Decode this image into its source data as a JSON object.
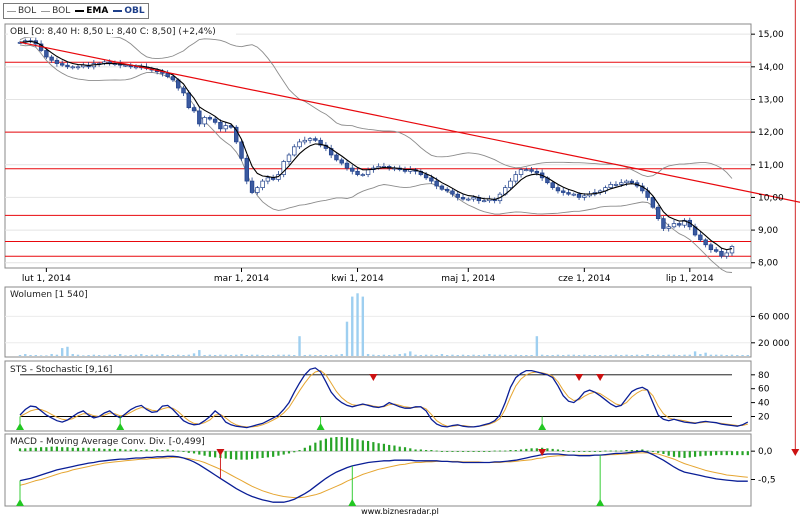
{
  "legend": [
    {
      "label": "BOL",
      "style": "thin"
    },
    {
      "label": "BOL",
      "style": "thin"
    },
    {
      "label": "EMA",
      "style": "ema"
    },
    {
      "label": "OBL",
      "style": "obl"
    }
  ],
  "footer": "www.biznesradar.pl",
  "colors": {
    "candle_body": "#3b5aa0",
    "candle_border": "#1e3f8a",
    "ema": "#000000",
    "bol": "#8c8c8c",
    "hline": "#e8080d",
    "volume": "#9ecff0",
    "stoch_k": "#0a1e96",
    "stoch_d": "#e6a632",
    "macd_pos": "#26a326",
    "macd_neg": "#26a326",
    "marker_up": "#22c722",
    "marker_down": "#cc1111"
  },
  "chart_data": [
    {
      "type": "candlestick",
      "title": "OBL [O: 8,40  H: 8,50  L: 8,40  C: 8,50] (+2,4%)",
      "x_tick_labels": [
        "lut 1, 2014",
        "mar 1, 2014",
        "kwi 1, 2014",
        "maj 1, 2014",
        "cze 1, 2014",
        "lip 1, 2014"
      ],
      "y_tick_labels": [
        "15,00",
        "14,00",
        "13,00",
        "12,00",
        "11,00",
        "10,00",
        "9,00",
        "8,00"
      ],
      "y_ticks": [
        15,
        14,
        13,
        12,
        11,
        10,
        9,
        8
      ],
      "ylim": [
        7.9,
        15.25
      ],
      "horizontal_lines": [
        14.14,
        12.0,
        10.88,
        9.45,
        8.65,
        8.2
      ],
      "trendline": {
        "x": [
          0,
          148
        ],
        "y": [
          14.75,
          9.85
        ]
      },
      "close": [
        14.75,
        14.8,
        14.8,
        14.7,
        14.5,
        14.3,
        14.2,
        14.1,
        14.05,
        14.0,
        14.0,
        14.0,
        14.05,
        14.0,
        14.1,
        14.1,
        14.15,
        14.1,
        14.1,
        14.05,
        14.05,
        14.0,
        14.0,
        14.0,
        13.95,
        13.9,
        13.85,
        13.8,
        13.7,
        13.6,
        13.35,
        13.2,
        12.75,
        12.65,
        12.25,
        12.45,
        12.4,
        12.3,
        12.1,
        12.2,
        12.15,
        11.7,
        11.2,
        10.5,
        10.15,
        10.3,
        10.5,
        10.6,
        10.55,
        10.7,
        11.1,
        11.3,
        11.55,
        11.7,
        11.75,
        11.8,
        11.75,
        11.6,
        11.5,
        11.3,
        11.15,
        11.05,
        10.9,
        10.8,
        10.7,
        10.7,
        10.85,
        10.9,
        10.95,
        10.95,
        10.9,
        10.9,
        10.85,
        10.8,
        10.85,
        10.8,
        10.7,
        10.6,
        10.5,
        10.35,
        10.25,
        10.2,
        10.1,
        10.0,
        9.95,
        9.95,
        10.0,
        9.9,
        9.9,
        9.95,
        9.9,
        10.1,
        10.3,
        10.5,
        10.7,
        10.85,
        10.85,
        10.8,
        10.75,
        10.6,
        10.45,
        10.3,
        10.2,
        10.15,
        10.1,
        10.1,
        10.0,
        10.05,
        10.1,
        10.15,
        10.2,
        10.3,
        10.4,
        10.4,
        10.45,
        10.5,
        10.45,
        10.35,
        10.2,
        10.0,
        9.7,
        9.35,
        9.05,
        9.1,
        9.2,
        9.15,
        9.3,
        9.1,
        8.85,
        8.7,
        8.55,
        8.4,
        8.35,
        8.2,
        8.3,
        8.5
      ]
    },
    {
      "type": "bar",
      "title": "Wolumen [1 540]",
      "y_tick_labels": [
        "60 000",
        "20 000"
      ],
      "y_ticks": [
        60000,
        20000
      ],
      "ylim": [
        0,
        100000
      ],
      "values": [
        1500,
        3000,
        1500,
        1500,
        1000,
        1000,
        3000,
        2000,
        12000,
        14000,
        3000,
        2000,
        1000,
        1500,
        2000,
        1500,
        1000,
        2000,
        1500,
        3000,
        1000,
        1500,
        2000,
        3000,
        1500,
        2000,
        2000,
        3000,
        1500,
        1500,
        2000,
        1500,
        2000,
        4000,
        9000,
        1500,
        2000,
        1500,
        2000,
        2000,
        1500,
        2000,
        3000,
        1500,
        2000,
        2000,
        1500,
        1000,
        1500,
        2000,
        2000,
        2000,
        1500,
        30000,
        1500,
        2000,
        1500,
        1500,
        1500,
        1500,
        2000,
        3000,
        52000,
        90000,
        95000,
        90000,
        3000,
        2000,
        1500,
        2000,
        1500,
        2000,
        3000,
        4000,
        7000,
        2000,
        1500,
        2000,
        2000,
        1500,
        3000,
        1500,
        2000,
        1500,
        2000,
        1500,
        2000,
        1500,
        2000,
        3000,
        2000,
        2000,
        2000,
        1500,
        2000,
        1500,
        1500,
        1500,
        30000,
        2000,
        1500,
        1500,
        2000,
        1500,
        2000,
        2000,
        1500,
        2000,
        1500,
        1500,
        1500,
        1000,
        1500,
        2000,
        1500,
        2000,
        1500,
        2000,
        1500,
        3000,
        1500,
        2000,
        1500,
        2000,
        2000,
        1500,
        2000,
        2000,
        7000,
        3000,
        5000,
        2000,
        2000,
        2000,
        1500,
        2000,
        1500,
        1500,
        1500
      ]
    },
    {
      "type": "line",
      "title": "STS - Stochastic [9,16]",
      "y_tick_labels": [
        "80",
        "60",
        "40",
        "20"
      ],
      "y_ticks": [
        80,
        60,
        40,
        20
      ],
      "ylim": [
        2,
        97
      ],
      "reference_lines": [
        80,
        20
      ],
      "series": [
        {
          "name": "K",
          "values": [
            22,
            30,
            35,
            34,
            28,
            22,
            18,
            14,
            12,
            15,
            20,
            25,
            28,
            22,
            18,
            20,
            25,
            28,
            22,
            18,
            24,
            30,
            34,
            36,
            30,
            26,
            27,
            35,
            36,
            30,
            22,
            14,
            10,
            8,
            9,
            14,
            20,
            28,
            22,
            12,
            8,
            6,
            5,
            4,
            6,
            8,
            10,
            14,
            18,
            22,
            30,
            40,
            55,
            68,
            80,
            88,
            90,
            84,
            70,
            55,
            46,
            40,
            36,
            34,
            36,
            38,
            36,
            34,
            33,
            35,
            40,
            37,
            34,
            32,
            32,
            34,
            34,
            28,
            16,
            9,
            6,
            5,
            7,
            8,
            6,
            5,
            5,
            6,
            8,
            10,
            14,
            22,
            40,
            62,
            76,
            82,
            86,
            86,
            84,
            82,
            80,
            76,
            64,
            50,
            42,
            40,
            46,
            55,
            58,
            55,
            50,
            44,
            38,
            34,
            36,
            46,
            56,
            60,
            62,
            58,
            40,
            22,
            16,
            14,
            16,
            14,
            12,
            11,
            10,
            12,
            13,
            12,
            11,
            9,
            8,
            7,
            6,
            8,
            12
          ]
        },
        {
          "name": "D",
          "values": [
            20,
            24,
            28,
            30,
            30,
            27,
            23,
            19,
            16,
            15,
            17,
            21,
            24,
            24,
            21,
            20,
            22,
            25,
            24,
            21,
            22,
            26,
            30,
            33,
            32,
            29,
            28,
            31,
            33,
            32,
            27,
            20,
            14,
            10,
            9,
            11,
            15,
            22,
            23,
            18,
            12,
            8,
            6,
            5,
            5,
            6,
            8,
            11,
            15,
            19,
            25,
            33,
            45,
            57,
            68,
            78,
            84,
            86,
            80,
            68,
            56,
            47,
            41,
            37,
            36,
            37,
            37,
            35,
            34,
            34,
            37,
            38,
            36,
            34,
            33,
            33,
            34,
            31,
            23,
            14,
            9,
            6,
            6,
            7,
            7,
            6,
            5,
            6,
            7,
            9,
            12,
            17,
            30,
            48,
            64,
            74,
            80,
            83,
            84,
            83,
            81,
            78,
            70,
            58,
            48,
            43,
            44,
            49,
            53,
            55,
            53,
            48,
            43,
            38,
            36,
            40,
            48,
            54,
            58,
            58,
            50,
            35,
            24,
            18,
            16,
            15,
            14,
            12,
            11,
            11,
            12,
            12,
            11,
            10,
            9,
            8,
            7,
            7,
            9
          ]
        }
      ],
      "markers": [
        {
          "type": "up",
          "x": 0
        },
        {
          "type": "up",
          "x": 19
        },
        {
          "type": "up",
          "x": 57
        },
        {
          "type": "down",
          "x": 67
        },
        {
          "type": "up",
          "x": 99
        },
        {
          "type": "down",
          "x": 106
        },
        {
          "type": "down",
          "x": 110
        }
      ]
    },
    {
      "type": "line",
      "title": "MACD - Moving Average Conv. Div. [-0,499]",
      "y_tick_labels": [
        "0,0",
        "-0,5"
      ],
      "y_ticks": [
        0,
        -0.5
      ],
      "ylim": [
        -0.95,
        0.25
      ],
      "series": [
        {
          "name": "MACD",
          "values": [
            -0.52,
            -0.5,
            -0.48,
            -0.45,
            -0.42,
            -0.39,
            -0.36,
            -0.33,
            -0.31,
            -0.29,
            -0.27,
            -0.25,
            -0.23,
            -0.21,
            -0.2,
            -0.18,
            -0.17,
            -0.16,
            -0.15,
            -0.14,
            -0.14,
            -0.13,
            -0.12,
            -0.12,
            -0.11,
            -0.11,
            -0.1,
            -0.1,
            -0.09,
            -0.09,
            -0.1,
            -0.12,
            -0.15,
            -0.19,
            -0.24,
            -0.3,
            -0.36,
            -0.42,
            -0.48,
            -0.54,
            -0.6,
            -0.66,
            -0.71,
            -0.76,
            -0.8,
            -0.83,
            -0.86,
            -0.88,
            -0.9,
            -0.9,
            -0.9,
            -0.88,
            -0.85,
            -0.8,
            -0.75,
            -0.69,
            -0.62,
            -0.55,
            -0.48,
            -0.42,
            -0.37,
            -0.33,
            -0.29,
            -0.26,
            -0.24,
            -0.22,
            -0.2,
            -0.19,
            -0.18,
            -0.17,
            -0.17,
            -0.16,
            -0.16,
            -0.16,
            -0.16,
            -0.17,
            -0.17,
            -0.17,
            -0.17,
            -0.17,
            -0.18,
            -0.18,
            -0.19,
            -0.19,
            -0.2,
            -0.2,
            -0.2,
            -0.2,
            -0.2,
            -0.2,
            -0.19,
            -0.19,
            -0.18,
            -0.17,
            -0.16,
            -0.14,
            -0.12,
            -0.1,
            -0.08,
            -0.06,
            -0.05,
            -0.05,
            -0.05,
            -0.06,
            -0.07,
            -0.07,
            -0.08,
            -0.08,
            -0.08,
            -0.07,
            -0.07,
            -0.06,
            -0.05,
            -0.04,
            -0.04,
            -0.03,
            -0.02,
            -0.01,
            0.0,
            -0.02,
            -0.06,
            -0.11,
            -0.16,
            -0.22,
            -0.28,
            -0.33,
            -0.37,
            -0.39,
            -0.41,
            -0.43,
            -0.45,
            -0.47,
            -0.49,
            -0.5,
            -0.51,
            -0.52,
            -0.53,
            -0.53,
            -0.53
          ]
        },
        {
          "name": "Signal",
          "values": [
            -0.6,
            -0.58,
            -0.55,
            -0.52,
            -0.5,
            -0.47,
            -0.44,
            -0.41,
            -0.38,
            -0.36,
            -0.33,
            -0.31,
            -0.29,
            -0.27,
            -0.25,
            -0.23,
            -0.21,
            -0.2,
            -0.19,
            -0.18,
            -0.17,
            -0.16,
            -0.15,
            -0.14,
            -0.14,
            -0.13,
            -0.13,
            -0.12,
            -0.12,
            -0.11,
            -0.11,
            -0.12,
            -0.13,
            -0.15,
            -0.17,
            -0.2,
            -0.24,
            -0.28,
            -0.32,
            -0.37,
            -0.42,
            -0.47,
            -0.52,
            -0.57,
            -0.62,
            -0.66,
            -0.7,
            -0.73,
            -0.76,
            -0.78,
            -0.8,
            -0.81,
            -0.82,
            -0.82,
            -0.81,
            -0.79,
            -0.77,
            -0.74,
            -0.7,
            -0.66,
            -0.62,
            -0.58,
            -0.53,
            -0.49,
            -0.45,
            -0.41,
            -0.38,
            -0.35,
            -0.32,
            -0.3,
            -0.28,
            -0.26,
            -0.24,
            -0.23,
            -0.21,
            -0.2,
            -0.2,
            -0.19,
            -0.19,
            -0.18,
            -0.18,
            -0.18,
            -0.18,
            -0.18,
            -0.19,
            -0.19,
            -0.19,
            -0.19,
            -0.2,
            -0.2,
            -0.2,
            -0.2,
            -0.19,
            -0.19,
            -0.18,
            -0.17,
            -0.16,
            -0.15,
            -0.13,
            -0.12,
            -0.1,
            -0.09,
            -0.08,
            -0.08,
            -0.07,
            -0.07,
            -0.07,
            -0.07,
            -0.07,
            -0.07,
            -0.07,
            -0.07,
            -0.06,
            -0.06,
            -0.05,
            -0.05,
            -0.04,
            -0.03,
            -0.03,
            -0.03,
            -0.04,
            -0.05,
            -0.08,
            -0.11,
            -0.14,
            -0.18,
            -0.22,
            -0.25,
            -0.28,
            -0.31,
            -0.34,
            -0.36,
            -0.38,
            -0.4,
            -0.42,
            -0.43,
            -0.44,
            -0.45,
            -0.46
          ]
        }
      ],
      "histogram": [
        0.05,
        0.05,
        0.06,
        0.06,
        0.07,
        0.07,
        0.08,
        0.08,
        0.07,
        0.07,
        0.06,
        0.06,
        0.06,
        0.06,
        0.05,
        0.05,
        0.04,
        0.04,
        0.04,
        0.04,
        0.03,
        0.03,
        0.03,
        0.02,
        0.03,
        0.02,
        0.03,
        0.02,
        0.03,
        0.02,
        0.01,
        -0.01,
        -0.03,
        -0.04,
        -0.06,
        -0.08,
        -0.1,
        -0.11,
        -0.12,
        -0.13,
        -0.14,
        -0.15,
        -0.15,
        -0.15,
        -0.14,
        -0.13,
        -0.12,
        -0.11,
        -0.1,
        -0.08,
        -0.06,
        -0.04,
        -0.02,
        0.02,
        0.06,
        0.1,
        0.15,
        0.19,
        0.22,
        0.24,
        0.25,
        0.25,
        0.24,
        0.23,
        0.21,
        0.19,
        0.18,
        0.16,
        0.14,
        0.13,
        0.11,
        0.1,
        0.08,
        0.07,
        0.05,
        0.03,
        0.03,
        0.02,
        0.02,
        0.01,
        0.0,
        0.0,
        -0.01,
        -0.01,
        -0.01,
        -0.01,
        -0.01,
        -0.01,
        0.0,
        0.0,
        0.01,
        0.01,
        0.01,
        0.02,
        0.02,
        0.03,
        0.04,
        0.05,
        0.05,
        0.06,
        0.05,
        0.04,
        0.03,
        0.02,
        0.0,
        0.0,
        -0.01,
        -0.01,
        -0.01,
        0.0,
        0.0,
        0.01,
        0.01,
        0.01,
        0.01,
        0.02,
        0.02,
        0.02,
        0.03,
        0.01,
        -0.01,
        -0.03,
        -0.05,
        -0.08,
        -0.1,
        -0.11,
        -0.12,
        -0.11,
        -0.1,
        -0.09,
        -0.08,
        -0.08,
        -0.07,
        -0.07,
        -0.07,
        -0.07,
        -0.07,
        -0.07,
        -0.07
      ],
      "markers": [
        {
          "type": "up",
          "x": 0
        },
        {
          "type": "down",
          "x": 38
        },
        {
          "type": "up",
          "x": 63
        },
        {
          "type": "down",
          "x": 99
        },
        {
          "type": "up",
          "x": 110
        },
        {
          "type": "down",
          "x": 147
        }
      ]
    }
  ]
}
